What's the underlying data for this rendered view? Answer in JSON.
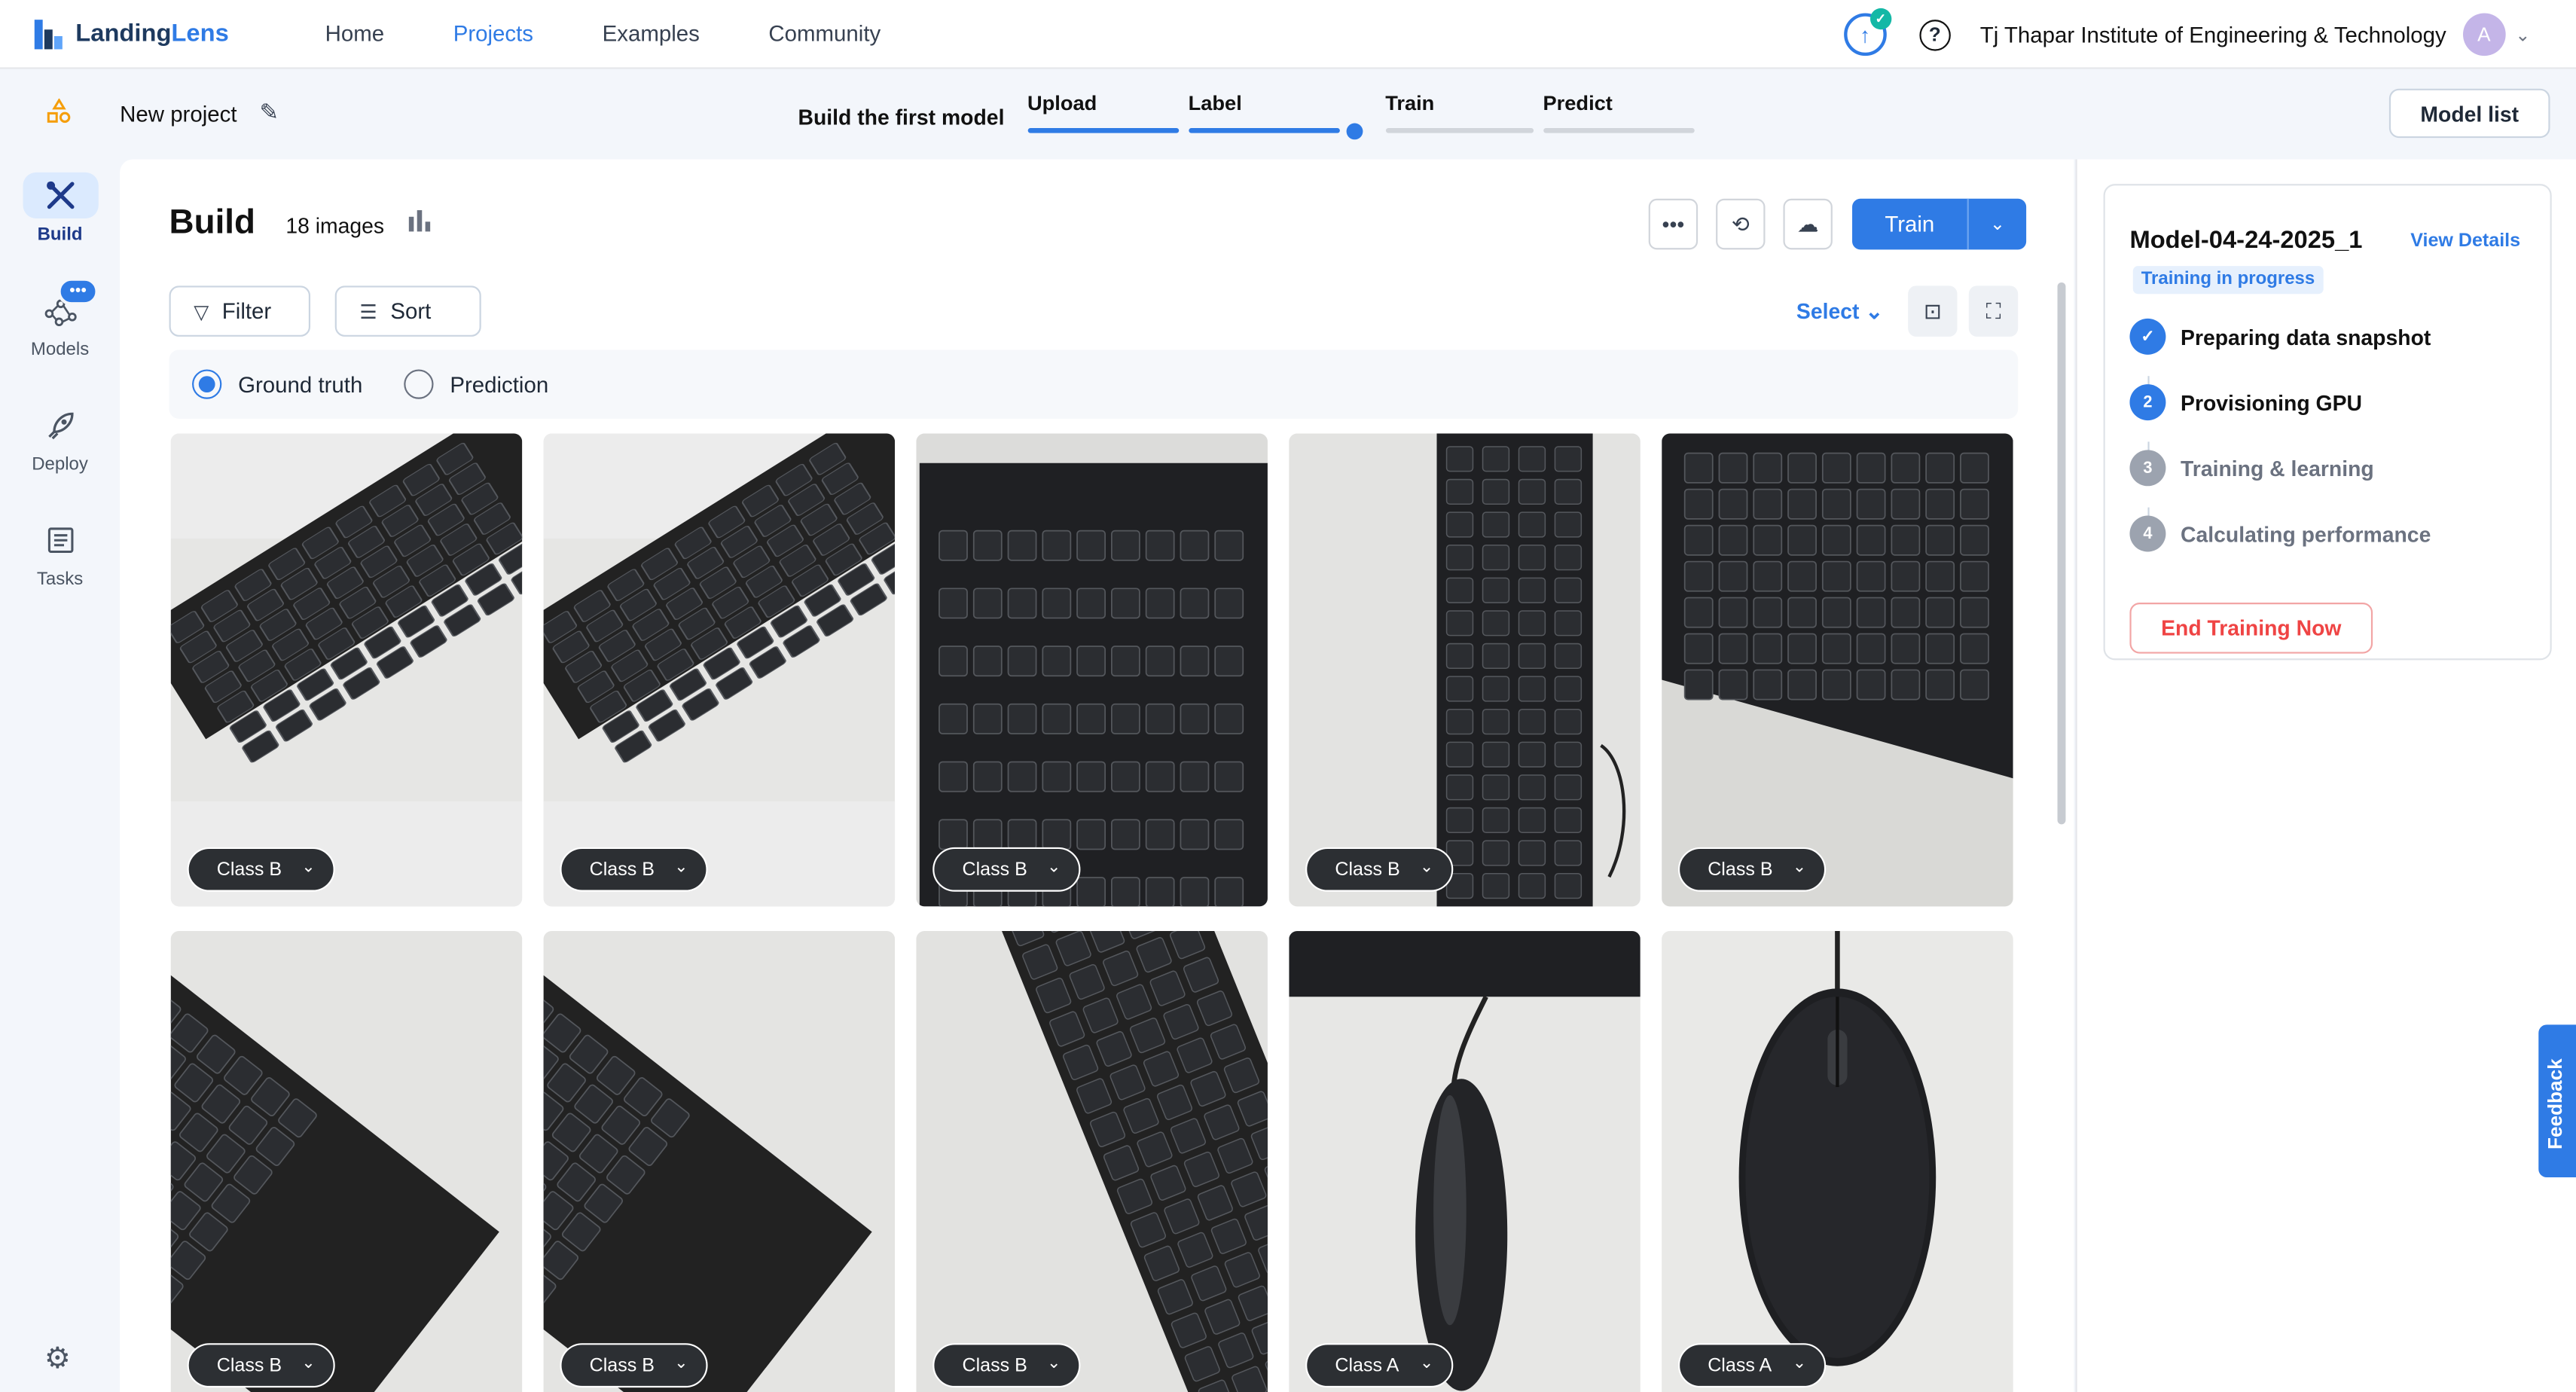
{
  "nav": {
    "brand_a": "Landing",
    "brand_b": "Lens",
    "links": [
      "Home",
      "Projects",
      "Examples",
      "Community"
    ],
    "active_link": "Projects",
    "org_name": "Tj Thapar Institute of Engineering & Technology",
    "avatar_initial": "A"
  },
  "subheader": {
    "project_name": "New project",
    "steps_title": "Build the first model",
    "steps": [
      {
        "label": "Upload",
        "state": "done"
      },
      {
        "label": "Label",
        "state": "done"
      },
      {
        "label": "Train",
        "state": "current"
      },
      {
        "label": "Predict",
        "state": "todo"
      }
    ],
    "model_list_label": "Model list"
  },
  "rail": {
    "items": [
      {
        "label": "Build",
        "icon": "tools-icon",
        "active": true
      },
      {
        "label": "Models",
        "icon": "models-icon",
        "badge": "•••"
      },
      {
        "label": "Deploy",
        "icon": "rocket-icon"
      },
      {
        "label": "Tasks",
        "icon": "tasks-icon"
      }
    ]
  },
  "main": {
    "title": "Build",
    "image_count": "18 images",
    "train_label": "Train",
    "filter_label": "Filter",
    "sort_label": "Sort",
    "select_label": "Select",
    "ground_truth_label": "Ground truth",
    "prediction_label": "Prediction",
    "view_mode": "Ground truth",
    "images": [
      {
        "tag": "Class B",
        "subject": "keyboard"
      },
      {
        "tag": "Class B",
        "subject": "keyboard"
      },
      {
        "tag": "Class B",
        "subject": "keyboard"
      },
      {
        "tag": "Class B",
        "subject": "keyboard"
      },
      {
        "tag": "Class B",
        "subject": "keyboard"
      },
      {
        "tag": "Class B",
        "subject": "keyboard"
      },
      {
        "tag": "Class B",
        "subject": "keyboard"
      },
      {
        "tag": "Class B",
        "subject": "keyboard"
      },
      {
        "tag": "Class A",
        "subject": "mouse"
      },
      {
        "tag": "Class A",
        "subject": "mouse"
      }
    ]
  },
  "training": {
    "model_name": "Model-04-24-2025_1",
    "view_details": "View Details",
    "status": "Training in progress",
    "steps": [
      {
        "num": "✓",
        "label": "Preparing data snapshot",
        "state": "done"
      },
      {
        "num": "2",
        "label": "Provisioning GPU",
        "state": "active"
      },
      {
        "num": "3",
        "label": "Training & learning",
        "state": "todo"
      },
      {
        "num": "4",
        "label": "Calculating performance",
        "state": "todo"
      }
    ],
    "end_label": "End Training Now"
  },
  "feedback_label": "Feedback",
  "colors": {
    "accent": "#2f7be5",
    "danger": "#ef4444",
    "brand_dark": "#1e3a5f"
  }
}
